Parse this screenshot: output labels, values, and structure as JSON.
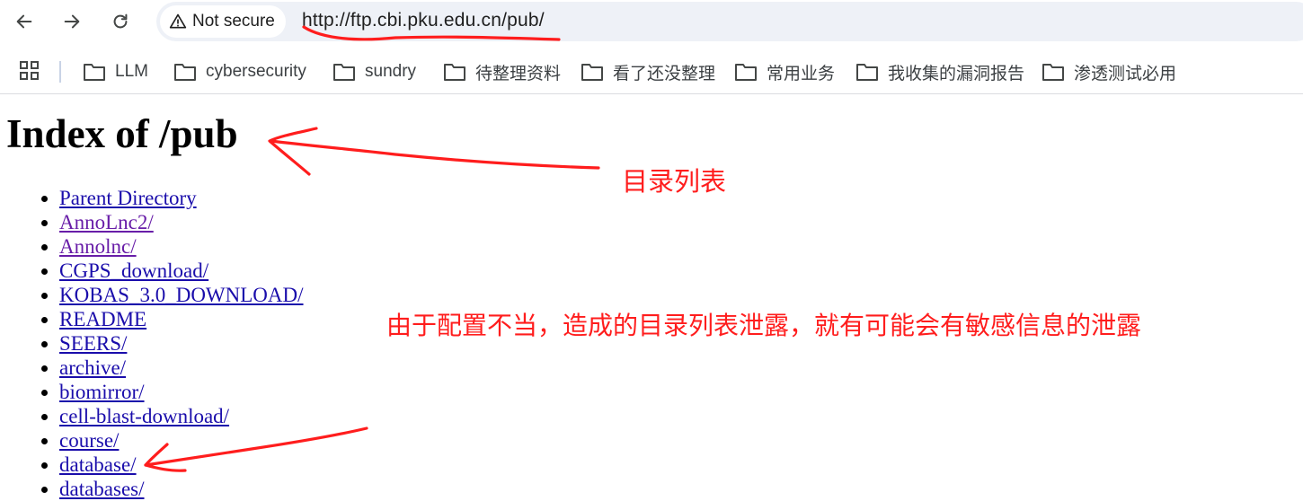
{
  "browser": {
    "security_label": "Not secure",
    "url": "http://ftp.cbi.pku.edu.cn/pub/",
    "icons": {
      "back": "back-arrow-icon",
      "forward": "forward-arrow-icon",
      "reload": "reload-icon",
      "security": "warning-triangle-icon",
      "apps": "apps-grid-icon",
      "folder": "folder-icon"
    }
  },
  "bookmarks": [
    {
      "label": "LLM"
    },
    {
      "label": "cybersecurity"
    },
    {
      "label": "sundry"
    },
    {
      "label": "待整理资料"
    },
    {
      "label": "看了还没整理"
    },
    {
      "label": "常用业务"
    },
    {
      "label": "我收集的漏洞报告"
    },
    {
      "label": "渗透测试必用"
    }
  ],
  "page": {
    "heading": "Index of /pub",
    "items": [
      {
        "label": "Parent Directory"
      },
      {
        "label": "AnnoLnc2/"
      },
      {
        "label": "Annolnc/"
      },
      {
        "label": "CGPS_download/"
      },
      {
        "label": "KOBAS_3.0_DOWNLOAD/"
      },
      {
        "label": "README"
      },
      {
        "label": "SEERS/"
      },
      {
        "label": "archive/"
      },
      {
        "label": "biomirror/"
      },
      {
        "label": "cell-blast-download/"
      },
      {
        "label": "course/"
      },
      {
        "label": "database/"
      },
      {
        "label": "databases/"
      }
    ]
  },
  "annotations": {
    "label_1": "目录列表",
    "label_2": "由于配置不当，造成的目录列表泄露，就有可能会有敏感信息的泄露",
    "color": "#ff1d1d"
  },
  "colors": {
    "link": "#1a0dab",
    "visited_link": "#681da8",
    "omnibox_bg": "#eef1f7"
  }
}
